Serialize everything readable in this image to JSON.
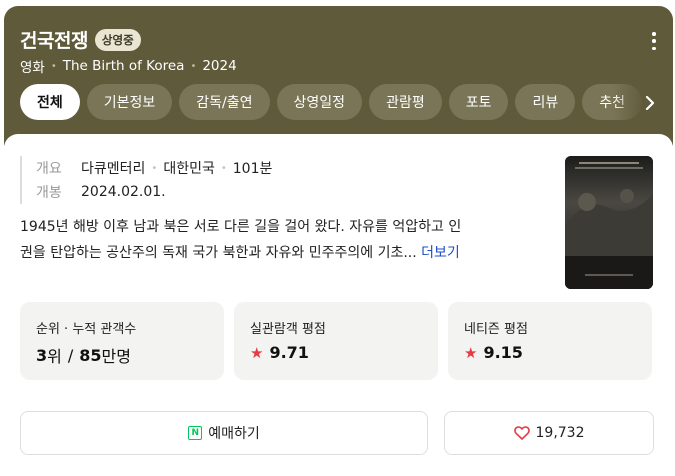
{
  "movie": {
    "title": "건국전쟁",
    "status_badge": "상영중",
    "category": "영화",
    "english_title": "The Birth of Korea",
    "year": "2024"
  },
  "tabs": [
    {
      "label": "전체",
      "active": true
    },
    {
      "label": "기본정보",
      "active": false
    },
    {
      "label": "감독/출연",
      "active": false
    },
    {
      "label": "상영일정",
      "active": false
    },
    {
      "label": "관람평",
      "active": false
    },
    {
      "label": "포토",
      "active": false
    },
    {
      "label": "리뷰",
      "active": false
    },
    {
      "label": "추천",
      "active": false
    }
  ],
  "info": {
    "overview_label": "개요",
    "genre": "다큐멘터리",
    "country": "대한민국",
    "runtime": "101분",
    "release_label": "개봉",
    "release_date": "2024.02.01."
  },
  "description": {
    "line1": "1945년 해방 이후 남과 북은 서로 다른 길을 걸어 왔다. 자유를 억압하고 인",
    "line2": "권을 탄압하는 공산주의 독재 국가 북한과 자유와 민주주의에 기초...",
    "more_label": "더보기"
  },
  "poster": {
    "title_text": "건국전쟁",
    "subtitle_text": "THE BIRTH OF KOREA"
  },
  "stats": {
    "rank": {
      "label": "순위 · 누적 관객수",
      "rank_value": "3",
      "rank_unit": "위",
      "separator": "/",
      "audience_value": "85",
      "audience_unit": "만명"
    },
    "audience_rating": {
      "label": "실관람객 평점",
      "value": "9.71"
    },
    "netizen_rating": {
      "label": "네티즌 평점",
      "value": "9.15"
    }
  },
  "actions": {
    "booking_label": "예매하기",
    "naver_icon_text": "N",
    "like_count": "19,732"
  },
  "colors": {
    "header_bg": "#5f5a3a",
    "tab_bg": "#7a7556",
    "star": "#e63b45",
    "link": "#1d4ec6",
    "naver_green": "#03c75a"
  }
}
